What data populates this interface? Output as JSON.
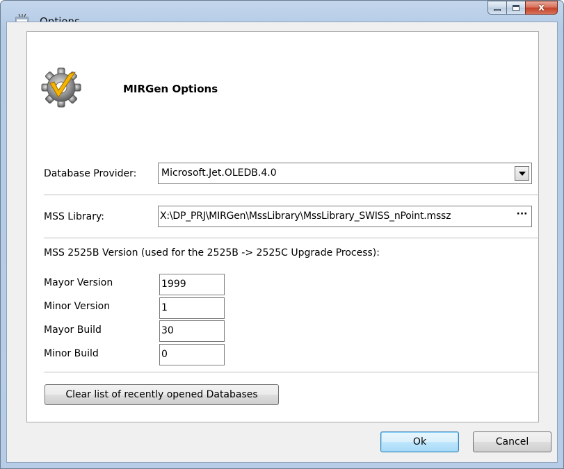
{
  "window": {
    "title": "Options",
    "close_glyph": "x",
    "app_icon": "cw-app-icon"
  },
  "header": {
    "title": "MIRGen Options",
    "icon": "gear-check-icon"
  },
  "database_provider": {
    "label": "Database Provider:",
    "value": "Microsoft.Jet.OLEDB.4.0"
  },
  "mss_library": {
    "label": "MSS Library:",
    "value": "X:\\DP_PRJ\\MIRGen\\MssLibrary\\MssLibrary_SWISS_nPoint.mssz",
    "browse_label": "···"
  },
  "version": {
    "heading": "MSS 2525B Version (used for the 2525B -> 2525C Upgrade Process):",
    "fields": [
      {
        "label": "Mayor Version",
        "value": "1999"
      },
      {
        "label": "Minor Version",
        "value": "1"
      },
      {
        "label": "Mayor Build",
        "value": "30"
      },
      {
        "label": "Minor Build",
        "value": "0"
      }
    ]
  },
  "clear_button": "Clear list of recently opened Databases",
  "buttons": {
    "ok": "Ok",
    "cancel": "Cancel"
  },
  "colors": {
    "titlebar": "#b9cfe8",
    "default_button_border": "#3c7fb1",
    "close_button": "#c3442a"
  }
}
